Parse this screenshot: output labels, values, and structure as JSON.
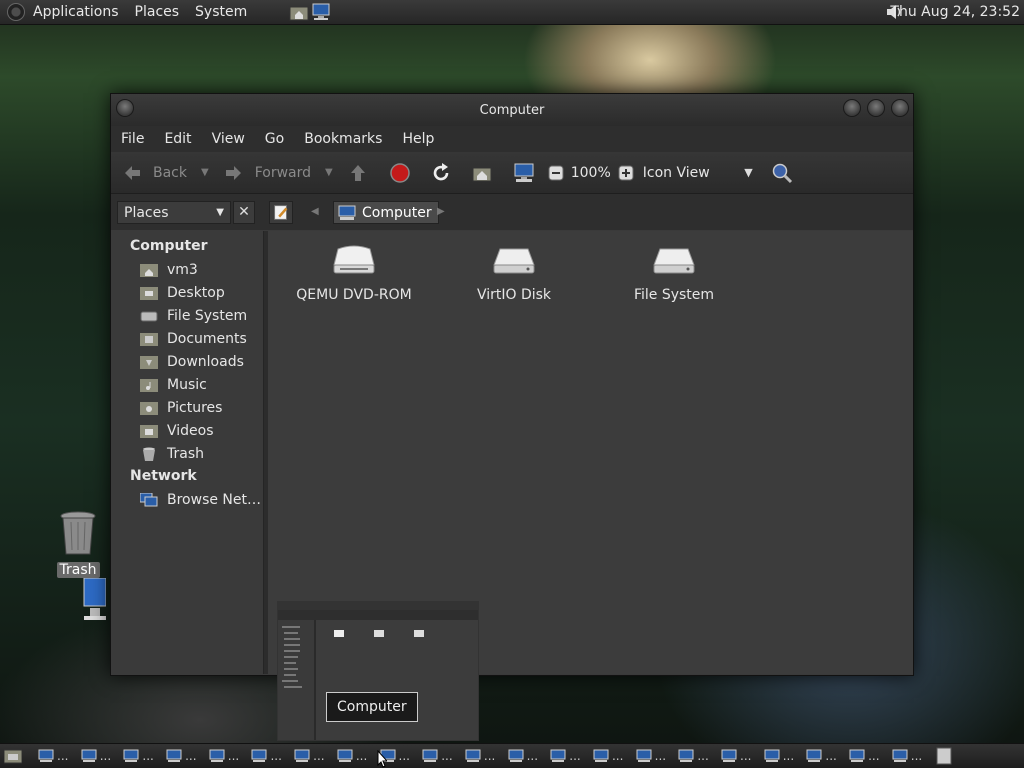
{
  "top_panel": {
    "menus": [
      "Applications",
      "Places",
      "System"
    ],
    "clock": "Thu Aug 24, 23:52"
  },
  "window": {
    "title": "Computer",
    "menubar": [
      "File",
      "Edit",
      "View",
      "Go",
      "Bookmarks",
      "Help"
    ],
    "toolbar": {
      "back_label": "Back",
      "forward_label": "Forward",
      "zoom": "100%",
      "view_mode": "Icon View"
    },
    "location": {
      "sidebar_mode": "Places",
      "current_crumb": "Computer"
    },
    "sidebar": {
      "computer_heading": "Computer",
      "computer_items": [
        {
          "label": "vm3",
          "icon": "home-folder-icon"
        },
        {
          "label": "Desktop",
          "icon": "desktop-folder-icon"
        },
        {
          "label": "File System",
          "icon": "filesystem-drive-icon"
        },
        {
          "label": "Documents",
          "icon": "folder-icon"
        },
        {
          "label": "Downloads",
          "icon": "folder-icon"
        },
        {
          "label": "Music",
          "icon": "music-folder-icon"
        },
        {
          "label": "Pictures",
          "icon": "pictures-folder-icon"
        },
        {
          "label": "Videos",
          "icon": "videos-folder-icon"
        },
        {
          "label": "Trash",
          "icon": "trash-icon"
        }
      ],
      "network_heading": "Network",
      "network_items": [
        {
          "label": "Browse Net…",
          "icon": "network-icon"
        }
      ]
    },
    "files": [
      {
        "label": "QEMU DVD-ROM",
        "icon": "optical-drive-icon"
      },
      {
        "label": "VirtIO Disk",
        "icon": "hard-disk-icon"
      },
      {
        "label": "File System",
        "icon": "hard-disk-icon"
      }
    ]
  },
  "desktop": {
    "trash_label": "Trash"
  },
  "tooltip": {
    "label": "Computer"
  },
  "taskbar": {
    "task_count": 21,
    "task_label": "..."
  },
  "colors": {
    "panel_bg": "#262626",
    "window_bg": "#3a3a3a",
    "stop_red": "#c41a1a",
    "crumb_bg": "#4a4a4a"
  }
}
